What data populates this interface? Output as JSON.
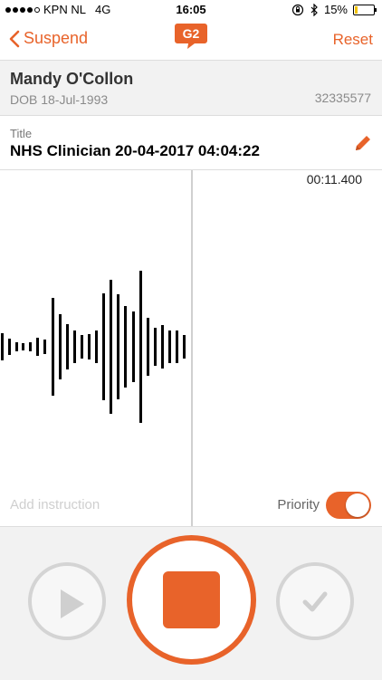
{
  "status_bar": {
    "carrier": "KPN NL",
    "network": "4G",
    "time": "16:05",
    "battery_percent": "15%",
    "battery_level": 0.15
  },
  "nav": {
    "back_label": "Suspend",
    "logo_text": "G2",
    "reset_label": "Reset"
  },
  "patient": {
    "name": "Mandy O'Collon",
    "dob": "DOB 18-Jul-1993",
    "id": "32335577"
  },
  "dictation": {
    "title_label": "Title",
    "title_value": "NHS Clinician 20-04-2017 04:04:22",
    "timer": "00:11.400",
    "instruction_placeholder": "Add instruction",
    "priority_label": "Priority",
    "priority_on": true
  },
  "colors": {
    "accent": "#e8632a",
    "panel_bg": "#f2f2f2"
  },
  "icons": {
    "back": "chevron-left-icon",
    "edit": "pencil-icon",
    "play": "play-icon",
    "stop": "stop-icon",
    "confirm": "checkmark-icon",
    "bluetooth": "bluetooth-icon",
    "orientation_lock": "orientation-lock-icon"
  }
}
